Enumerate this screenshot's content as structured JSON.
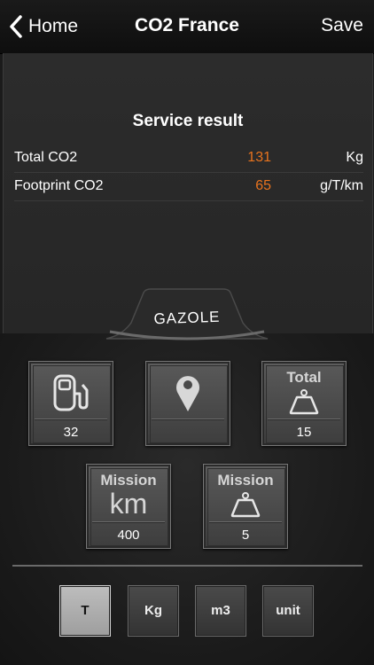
{
  "nav": {
    "back_label": "Home",
    "title": "CO2 France",
    "save_label": "Save"
  },
  "result": {
    "title": "Service result",
    "rows": [
      {
        "label": "Total CO2",
        "value": "131",
        "unit": "Kg"
      },
      {
        "label": "Footprint CO2",
        "value": "65",
        "unit": "g/T/km"
      }
    ]
  },
  "fuel": {
    "label": "GAZOLE"
  },
  "tiles": {
    "fuel": {
      "icon": "fuel-pump-icon",
      "value": "32"
    },
    "location": {
      "icon": "map-pin-icon",
      "value": ""
    },
    "total": {
      "heading": "Total",
      "icon": "weight-icon",
      "value": "15"
    },
    "mission_km": {
      "heading": "Mission",
      "big": "km",
      "value": "400"
    },
    "mission_weight": {
      "heading": "Mission",
      "icon": "weight-icon",
      "value": "5"
    }
  },
  "units": [
    {
      "label": "T",
      "selected": true
    },
    {
      "label": "Kg",
      "selected": false
    },
    {
      "label": "m3",
      "selected": false
    },
    {
      "label": "unit",
      "selected": false
    }
  ],
  "colors": {
    "accent": "#e8731e",
    "selected": "#b0b0b0"
  }
}
